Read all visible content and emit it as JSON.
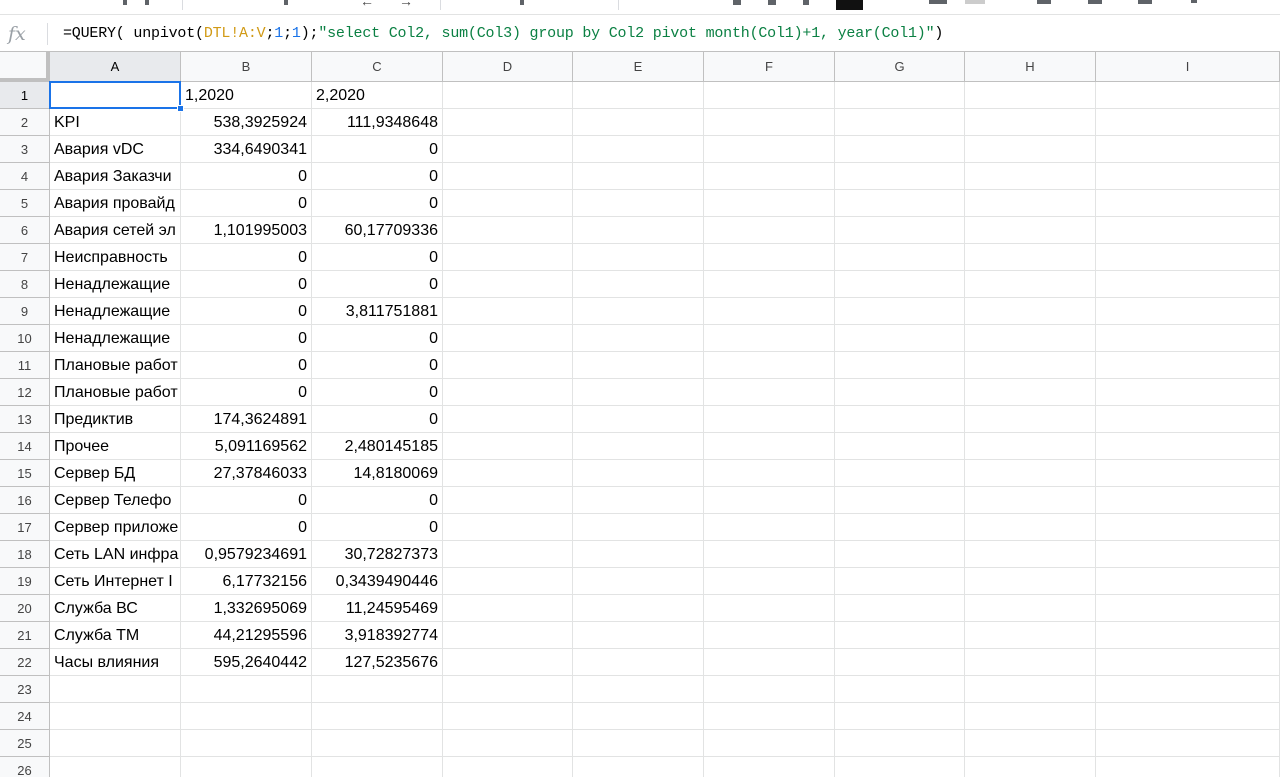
{
  "formula_bar": {
    "fx_label": "fx",
    "formula_prefix": "=QUERY( unpivot(",
    "formula_range": "DTL!A:V",
    "formula_sep1": ";",
    "formula_num1": "1",
    "formula_sep2": ";",
    "formula_num2": "1",
    "formula_mid": ");",
    "formula_string": "\"select Col2, sum(Col3) group by Col2 pivot month(Col1)+1, year(Col1)\"",
    "formula_suffix": ")"
  },
  "columns": [
    "A",
    "B",
    "C",
    "D",
    "E",
    "F",
    "G",
    "H",
    "I"
  ],
  "rows": [
    "1",
    "2",
    "3",
    "4",
    "5",
    "6",
    "7",
    "8",
    "9",
    "10",
    "11",
    "12",
    "13",
    "14",
    "15",
    "16",
    "17",
    "18",
    "19",
    "20",
    "21",
    "22",
    "23",
    "24",
    "25",
    "26"
  ],
  "active_cell": "A1",
  "cells": [
    [
      "",
      "1,2020",
      "2,2020"
    ],
    [
      "KPI",
      "538,3925924",
      "111,9348648"
    ],
    [
      "Авария vDC",
      "334,6490341",
      "0"
    ],
    [
      "Авария Заказчи",
      "0",
      "0"
    ],
    [
      "Авария провайд",
      "0",
      "0"
    ],
    [
      "Авария сетей эл",
      "1,101995003",
      "60,17709336"
    ],
    [
      "Неисправность",
      "0",
      "0"
    ],
    [
      "Ненадлежащие",
      "0",
      "0"
    ],
    [
      "Ненадлежащие",
      "0",
      "3,811751881"
    ],
    [
      "Ненадлежащие",
      "0",
      "0"
    ],
    [
      "Плановые работ",
      "0",
      "0"
    ],
    [
      "Плановые работ",
      "0",
      "0"
    ],
    [
      "Предиктив",
      "174,3624891",
      "0"
    ],
    [
      "Прочее",
      "5,091169562",
      "2,480145185"
    ],
    [
      "Сервер БД",
      "27,37846033",
      "14,8180069"
    ],
    [
      "Сервер Телефо",
      "0",
      "0"
    ],
    [
      "Сервер приложе",
      "0",
      "0"
    ],
    [
      "Сеть LAN инфра",
      "0,9579234691",
      "30,72827373"
    ],
    [
      "Сеть Интернет I",
      "6,17732156",
      "0,3439490446"
    ],
    [
      "Служба ВС",
      "1,332695069",
      "11,24595469"
    ],
    [
      "Служба ТМ",
      "44,21295596",
      "3,918392774"
    ],
    [
      "Часы влияния",
      "595,2640442",
      "127,5235676"
    ]
  ]
}
